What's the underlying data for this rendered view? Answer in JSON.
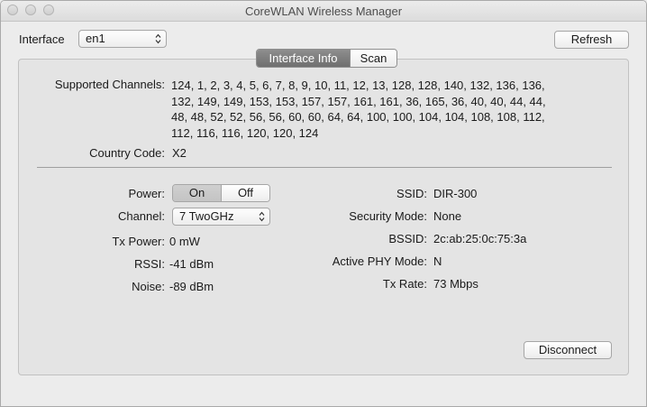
{
  "window": {
    "title": "CoreWLAN Wireless Manager"
  },
  "toolbar": {
    "interface_label": "Interface",
    "interface_value": "en1",
    "refresh_label": "Refresh"
  },
  "tabs": [
    {
      "label": "Interface Info",
      "selected": true
    },
    {
      "label": "Scan",
      "selected": false
    }
  ],
  "info": {
    "supported_channels_label": "Supported Channels:",
    "supported_channels_lines": [
      "124, 1, 2, 3, 4, 5, 6, 7, 8, 9, 10, 11, 12, 13, 128, 128, 140, 132, 136, 136,",
      "132, 149, 149, 153, 153, 157, 157, 161, 161, 36, 165, 36, 40, 40, 44, 44,",
      "48, 48, 52, 52, 56, 56, 60, 60, 64, 64, 100, 100, 104, 104, 108, 108, 112,",
      "112, 116, 116, 120, 120, 124"
    ],
    "country_code_label": "Country Code:",
    "country_code_value": "X2"
  },
  "left": {
    "power_label": "Power:",
    "power_on": "On",
    "power_off": "Off",
    "power_state": "On",
    "channel_label": "Channel:",
    "channel_value": "7 TwoGHz",
    "tx_power_label": "Tx Power:",
    "tx_power_value": "0 mW",
    "rssi_label": "RSSI:",
    "rssi_value": "-41 dBm",
    "noise_label": "Noise:",
    "noise_value": "-89 dBm"
  },
  "right": {
    "ssid_label": "SSID:",
    "ssid_value": "DIR-300",
    "security_label": "Security Mode:",
    "security_value": "None",
    "bssid_label": "BSSID:",
    "bssid_value": "2c:ab:25:0c:75:3a",
    "phy_label": "Active PHY Mode:",
    "phy_value": "N",
    "tx_rate_label": "Tx Rate:",
    "tx_rate_value": "73 Mbps"
  },
  "actions": {
    "disconnect_label": "Disconnect"
  },
  "icons": {
    "close": "close-icon",
    "minimize": "minimize-icon",
    "zoom": "zoom-icon",
    "popup_arrows": "chevron-updown-icon"
  }
}
